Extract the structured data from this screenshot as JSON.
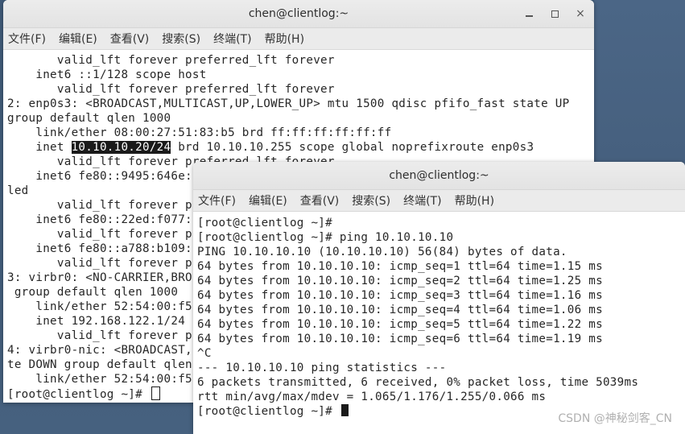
{
  "back_window": {
    "title": "chen@clientlog:~",
    "menu": [
      "文件(F)",
      "编辑(E)",
      "查看(V)",
      "搜索(S)",
      "终端(T)",
      "帮助(H)"
    ],
    "lines": [
      {
        "text": "       valid_lft forever preferred_lft forever"
      },
      {
        "text": "    inet6 ::1/128 scope host"
      },
      {
        "text": "       valid_lft forever preferred_lft forever"
      },
      {
        "text": "2: enp0s3: <BROADCAST,MULTICAST,UP,LOWER_UP> mtu 1500 qdisc pfifo_fast state UP"
      },
      {
        "text": "group default qlen 1000"
      },
      {
        "text": "    link/ether 08:00:27:51:83:b5 brd ff:ff:ff:ff:ff:ff"
      },
      {
        "pre": "    inet ",
        "hl": "10.10.10.20/24",
        "post": " brd 10.10.10.255 scope global noprefixroute enp0s3"
      },
      {
        "text": "       valid_lft forever preferred_lft forever"
      },
      {
        "text": "    inet6 fe80::9495:646e:"
      },
      {
        "text": "led"
      },
      {
        "text": "       valid_lft forever p"
      },
      {
        "text": "    inet6 fe80::22ed:f077:"
      },
      {
        "text": "       valid_lft forever p"
      },
      {
        "text": "    inet6 fe80::a788:b109:"
      },
      {
        "text": "       valid_lft forever p"
      },
      {
        "text": "3: virbr0: <NO-CARRIER,BRO"
      },
      {
        "text": " group default qlen 1000"
      },
      {
        "text": "    link/ether 52:54:00:f5"
      },
      {
        "text": "    inet 192.168.122.1/24"
      },
      {
        "text": "       valid_lft forever p"
      },
      {
        "text": "4: virbr0-nic: <BROADCAST,"
      },
      {
        "text": "te DOWN group default qlen"
      },
      {
        "text": "    link/ether 52:54:00:f5"
      },
      {
        "text": "[root@clientlog ~]# ",
        "cursor": "hollow"
      }
    ]
  },
  "front_window": {
    "title": "chen@clientlog:~",
    "menu": [
      "文件(F)",
      "编辑(E)",
      "查看(V)",
      "搜索(S)",
      "终端(T)",
      "帮助(H)"
    ],
    "lines": [
      {
        "text": "[root@clientlog ~]#"
      },
      {
        "text": "[root@clientlog ~]# ping 10.10.10.10"
      },
      {
        "text": "PING 10.10.10.10 (10.10.10.10) 56(84) bytes of data."
      },
      {
        "text": "64 bytes from 10.10.10.10: icmp_seq=1 ttl=64 time=1.15 ms"
      },
      {
        "text": "64 bytes from 10.10.10.10: icmp_seq=2 ttl=64 time=1.25 ms"
      },
      {
        "text": "64 bytes from 10.10.10.10: icmp_seq=3 ttl=64 time=1.16 ms"
      },
      {
        "text": "64 bytes from 10.10.10.10: icmp_seq=4 ttl=64 time=1.06 ms"
      },
      {
        "text": "64 bytes from 10.10.10.10: icmp_seq=5 ttl=64 time=1.22 ms"
      },
      {
        "text": "64 bytes from 10.10.10.10: icmp_seq=6 ttl=64 time=1.19 ms"
      },
      {
        "text": "^C"
      },
      {
        "text": "--- 10.10.10.10 ping statistics ---"
      },
      {
        "text": "6 packets transmitted, 6 received, 0% packet loss, time 5039ms"
      },
      {
        "text": "rtt min/avg/max/mdev = 1.065/1.176/1.255/0.066 ms"
      },
      {
        "text": "[root@clientlog ~]# ",
        "cursor": "block"
      }
    ]
  },
  "watermark": "CSDN @神秘剑客_CN",
  "window_controls": {
    "minimize": "minimize-icon",
    "maximize": "maximize-icon",
    "close": "×"
  }
}
